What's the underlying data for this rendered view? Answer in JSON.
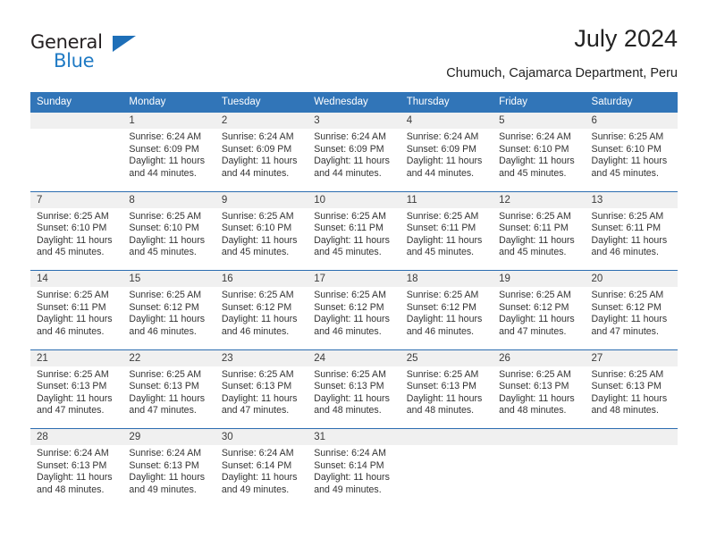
{
  "brand": {
    "name_part1": "General",
    "name_part2": "Blue",
    "triangle_color": "#1e6fb8",
    "blue_text_color": "#1f7ac4"
  },
  "header": {
    "title": "July 2024",
    "location": "Chumuch, Cajamarca Department, Peru",
    "header_bg_color": "#3175b8",
    "number_row_bg_color": "#f0f0f0",
    "week_divider_color": "#2c6db0"
  },
  "weekday_headers": [
    "Sunday",
    "Monday",
    "Tuesday",
    "Wednesday",
    "Thursday",
    "Friday",
    "Saturday"
  ],
  "weeks": [
    {
      "numbers": [
        "",
        "1",
        "2",
        "3",
        "4",
        "5",
        "6"
      ],
      "details": [
        {
          "empty": true
        },
        {
          "sunrise": "Sunrise: 6:24 AM",
          "sunset": "Sunset: 6:09 PM",
          "daylight1": "Daylight: 11 hours",
          "daylight2": "and 44 minutes."
        },
        {
          "sunrise": "Sunrise: 6:24 AM",
          "sunset": "Sunset: 6:09 PM",
          "daylight1": "Daylight: 11 hours",
          "daylight2": "and 44 minutes."
        },
        {
          "sunrise": "Sunrise: 6:24 AM",
          "sunset": "Sunset: 6:09 PM",
          "daylight1": "Daylight: 11 hours",
          "daylight2": "and 44 minutes."
        },
        {
          "sunrise": "Sunrise: 6:24 AM",
          "sunset": "Sunset: 6:09 PM",
          "daylight1": "Daylight: 11 hours",
          "daylight2": "and 44 minutes."
        },
        {
          "sunrise": "Sunrise: 6:24 AM",
          "sunset": "Sunset: 6:10 PM",
          "daylight1": "Daylight: 11 hours",
          "daylight2": "and 45 minutes."
        },
        {
          "sunrise": "Sunrise: 6:25 AM",
          "sunset": "Sunset: 6:10 PM",
          "daylight1": "Daylight: 11 hours",
          "daylight2": "and 45 minutes."
        }
      ]
    },
    {
      "numbers": [
        "7",
        "8",
        "9",
        "10",
        "11",
        "12",
        "13"
      ],
      "details": [
        {
          "sunrise": "Sunrise: 6:25 AM",
          "sunset": "Sunset: 6:10 PM",
          "daylight1": "Daylight: 11 hours",
          "daylight2": "and 45 minutes."
        },
        {
          "sunrise": "Sunrise: 6:25 AM",
          "sunset": "Sunset: 6:10 PM",
          "daylight1": "Daylight: 11 hours",
          "daylight2": "and 45 minutes."
        },
        {
          "sunrise": "Sunrise: 6:25 AM",
          "sunset": "Sunset: 6:10 PM",
          "daylight1": "Daylight: 11 hours",
          "daylight2": "and 45 minutes."
        },
        {
          "sunrise": "Sunrise: 6:25 AM",
          "sunset": "Sunset: 6:11 PM",
          "daylight1": "Daylight: 11 hours",
          "daylight2": "and 45 minutes."
        },
        {
          "sunrise": "Sunrise: 6:25 AM",
          "sunset": "Sunset: 6:11 PM",
          "daylight1": "Daylight: 11 hours",
          "daylight2": "and 45 minutes."
        },
        {
          "sunrise": "Sunrise: 6:25 AM",
          "sunset": "Sunset: 6:11 PM",
          "daylight1": "Daylight: 11 hours",
          "daylight2": "and 45 minutes."
        },
        {
          "sunrise": "Sunrise: 6:25 AM",
          "sunset": "Sunset: 6:11 PM",
          "daylight1": "Daylight: 11 hours",
          "daylight2": "and 46 minutes."
        }
      ]
    },
    {
      "numbers": [
        "14",
        "15",
        "16",
        "17",
        "18",
        "19",
        "20"
      ],
      "details": [
        {
          "sunrise": "Sunrise: 6:25 AM",
          "sunset": "Sunset: 6:11 PM",
          "daylight1": "Daylight: 11 hours",
          "daylight2": "and 46 minutes."
        },
        {
          "sunrise": "Sunrise: 6:25 AM",
          "sunset": "Sunset: 6:12 PM",
          "daylight1": "Daylight: 11 hours",
          "daylight2": "and 46 minutes."
        },
        {
          "sunrise": "Sunrise: 6:25 AM",
          "sunset": "Sunset: 6:12 PM",
          "daylight1": "Daylight: 11 hours",
          "daylight2": "and 46 minutes."
        },
        {
          "sunrise": "Sunrise: 6:25 AM",
          "sunset": "Sunset: 6:12 PM",
          "daylight1": "Daylight: 11 hours",
          "daylight2": "and 46 minutes."
        },
        {
          "sunrise": "Sunrise: 6:25 AM",
          "sunset": "Sunset: 6:12 PM",
          "daylight1": "Daylight: 11 hours",
          "daylight2": "and 46 minutes."
        },
        {
          "sunrise": "Sunrise: 6:25 AM",
          "sunset": "Sunset: 6:12 PM",
          "daylight1": "Daylight: 11 hours",
          "daylight2": "and 47 minutes."
        },
        {
          "sunrise": "Sunrise: 6:25 AM",
          "sunset": "Sunset: 6:12 PM",
          "daylight1": "Daylight: 11 hours",
          "daylight2": "and 47 minutes."
        }
      ]
    },
    {
      "numbers": [
        "21",
        "22",
        "23",
        "24",
        "25",
        "26",
        "27"
      ],
      "details": [
        {
          "sunrise": "Sunrise: 6:25 AM",
          "sunset": "Sunset: 6:13 PM",
          "daylight1": "Daylight: 11 hours",
          "daylight2": "and 47 minutes."
        },
        {
          "sunrise": "Sunrise: 6:25 AM",
          "sunset": "Sunset: 6:13 PM",
          "daylight1": "Daylight: 11 hours",
          "daylight2": "and 47 minutes."
        },
        {
          "sunrise": "Sunrise: 6:25 AM",
          "sunset": "Sunset: 6:13 PM",
          "daylight1": "Daylight: 11 hours",
          "daylight2": "and 47 minutes."
        },
        {
          "sunrise": "Sunrise: 6:25 AM",
          "sunset": "Sunset: 6:13 PM",
          "daylight1": "Daylight: 11 hours",
          "daylight2": "and 48 minutes."
        },
        {
          "sunrise": "Sunrise: 6:25 AM",
          "sunset": "Sunset: 6:13 PM",
          "daylight1": "Daylight: 11 hours",
          "daylight2": "and 48 minutes."
        },
        {
          "sunrise": "Sunrise: 6:25 AM",
          "sunset": "Sunset: 6:13 PM",
          "daylight1": "Daylight: 11 hours",
          "daylight2": "and 48 minutes."
        },
        {
          "sunrise": "Sunrise: 6:25 AM",
          "sunset": "Sunset: 6:13 PM",
          "daylight1": "Daylight: 11 hours",
          "daylight2": "and 48 minutes."
        }
      ]
    },
    {
      "numbers": [
        "28",
        "29",
        "30",
        "31",
        "",
        "",
        ""
      ],
      "details": [
        {
          "sunrise": "Sunrise: 6:24 AM",
          "sunset": "Sunset: 6:13 PM",
          "daylight1": "Daylight: 11 hours",
          "daylight2": "and 48 minutes."
        },
        {
          "sunrise": "Sunrise: 6:24 AM",
          "sunset": "Sunset: 6:13 PM",
          "daylight1": "Daylight: 11 hours",
          "daylight2": "and 49 minutes."
        },
        {
          "sunrise": "Sunrise: 6:24 AM",
          "sunset": "Sunset: 6:14 PM",
          "daylight1": "Daylight: 11 hours",
          "daylight2": "and 49 minutes."
        },
        {
          "sunrise": "Sunrise: 6:24 AM",
          "sunset": "Sunset: 6:14 PM",
          "daylight1": "Daylight: 11 hours",
          "daylight2": "and 49 minutes."
        },
        {
          "empty": true
        },
        {
          "empty": true
        },
        {
          "empty": true
        }
      ]
    }
  ]
}
